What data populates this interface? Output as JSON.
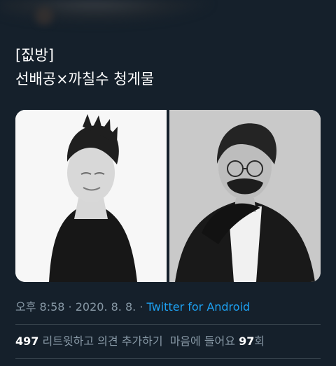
{
  "tweet": {
    "line1": "[짒방]",
    "line2": "선배공×까칠수  청게물"
  },
  "media": {
    "photos": [
      {
        "name": "left-photo",
        "background": "#f7f7f7"
      },
      {
        "name": "right-photo",
        "background": "#c9c9c9"
      }
    ]
  },
  "meta": {
    "time": "오후 8:58",
    "sep1": " · ",
    "date": "2020. 8. 8.",
    "sep2": " · ",
    "source": "Twitter for Android"
  },
  "stats": {
    "retweet_count": "497",
    "retweet_label": " 리트윗하고 의견 추가하기",
    "like_prefix": "마음에 들어요 ",
    "like_count": "97",
    "like_suffix": "회"
  },
  "colors": {
    "background": "#15202b",
    "text_primary": "#ffffff",
    "text_secondary": "#8899a6",
    "link": "#1da1f2",
    "divider": "#38444d"
  }
}
